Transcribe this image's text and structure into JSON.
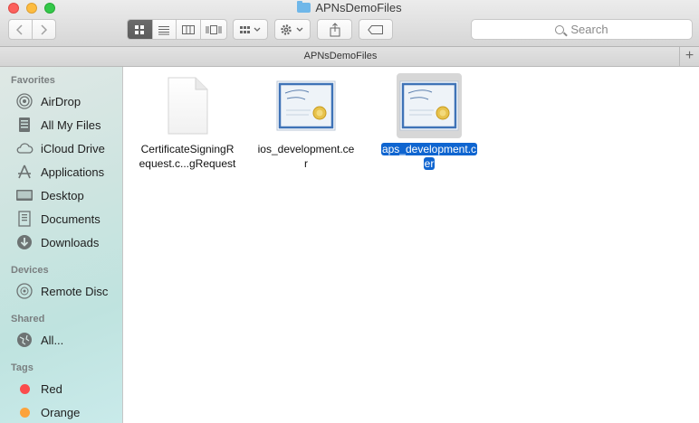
{
  "window": {
    "title": "APNsDemoFiles",
    "path_title": "APNsDemoFiles",
    "add_tab_label": "+"
  },
  "toolbar": {
    "search_placeholder": "Search"
  },
  "sidebar": {
    "favorites_heading": "Favorites",
    "favorites": [
      {
        "label": "AirDrop",
        "icon": "airdrop-icon"
      },
      {
        "label": "All My Files",
        "icon": "all-files-icon"
      },
      {
        "label": "iCloud Drive",
        "icon": "cloud-icon"
      },
      {
        "label": "Applications",
        "icon": "applications-icon"
      },
      {
        "label": "Desktop",
        "icon": "desktop-icon"
      },
      {
        "label": "Documents",
        "icon": "documents-icon"
      },
      {
        "label": "Downloads",
        "icon": "downloads-icon"
      }
    ],
    "devices_heading": "Devices",
    "devices": [
      {
        "label": "Remote Disc",
        "icon": "disc-icon"
      }
    ],
    "shared_heading": "Shared",
    "shared": [
      {
        "label": "All...",
        "icon": "network-icon"
      }
    ],
    "tags_heading": "Tags",
    "tags": [
      {
        "label": "Red",
        "color": "#fb4c4c"
      },
      {
        "label": "Orange",
        "color": "#fca33b"
      }
    ]
  },
  "files": [
    {
      "line1": "CertificateSigningR",
      "line2": "equest.c...gRequest",
      "icon": "document-icon",
      "selected": false
    },
    {
      "line1": "ios_development.ce",
      "line2": "r",
      "icon": "certificate-icon",
      "selected": false
    },
    {
      "line1": "aps_development.c",
      "line2": "er",
      "icon": "certificate-icon",
      "selected": true
    }
  ]
}
